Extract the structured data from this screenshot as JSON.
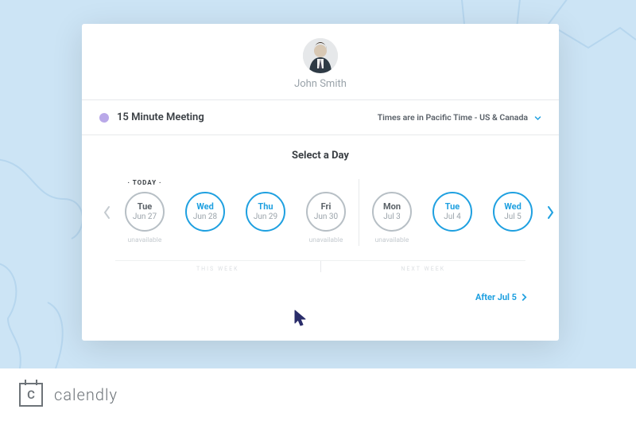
{
  "host_name": "John Smith",
  "meeting": {
    "title": "15 Minute Meeting",
    "color": "#b9a8e8"
  },
  "timezone": {
    "label": "Times are in Pacific Time - US & Canada"
  },
  "section_title": "Select a Day",
  "today_label": "· TODAY ·",
  "week_labels": {
    "this": "THIS WEEK",
    "next": "NEXT WEEK"
  },
  "days": {
    "this_week": [
      {
        "dow": "Tue",
        "date": "Jun 27",
        "available": false,
        "status": "unavailable",
        "is_today": true
      },
      {
        "dow": "Wed",
        "date": "Jun 28",
        "available": true,
        "status": "",
        "is_today": false
      },
      {
        "dow": "Thu",
        "date": "Jun 29",
        "available": true,
        "status": "",
        "is_today": false
      },
      {
        "dow": "Fri",
        "date": "Jun 30",
        "available": false,
        "status": "unavailable",
        "is_today": false
      }
    ],
    "next_week": [
      {
        "dow": "Mon",
        "date": "Jul 3",
        "available": false,
        "status": "unavailable",
        "is_today": false
      },
      {
        "dow": "Tue",
        "date": "Jul 4",
        "available": true,
        "status": "",
        "is_today": false
      },
      {
        "dow": "Wed",
        "date": "Jul 5",
        "available": true,
        "status": "",
        "is_today": false
      }
    ]
  },
  "after_label": "After Jul 5",
  "brand": "calendly",
  "logo_letter": "C",
  "icons": {
    "prev": "chevron-left-icon",
    "next": "chevron-right-icon",
    "tz_chevron": "chevron-down-icon",
    "after_chevron": "chevron-right-icon",
    "cursor": "mouse-cursor-icon"
  }
}
